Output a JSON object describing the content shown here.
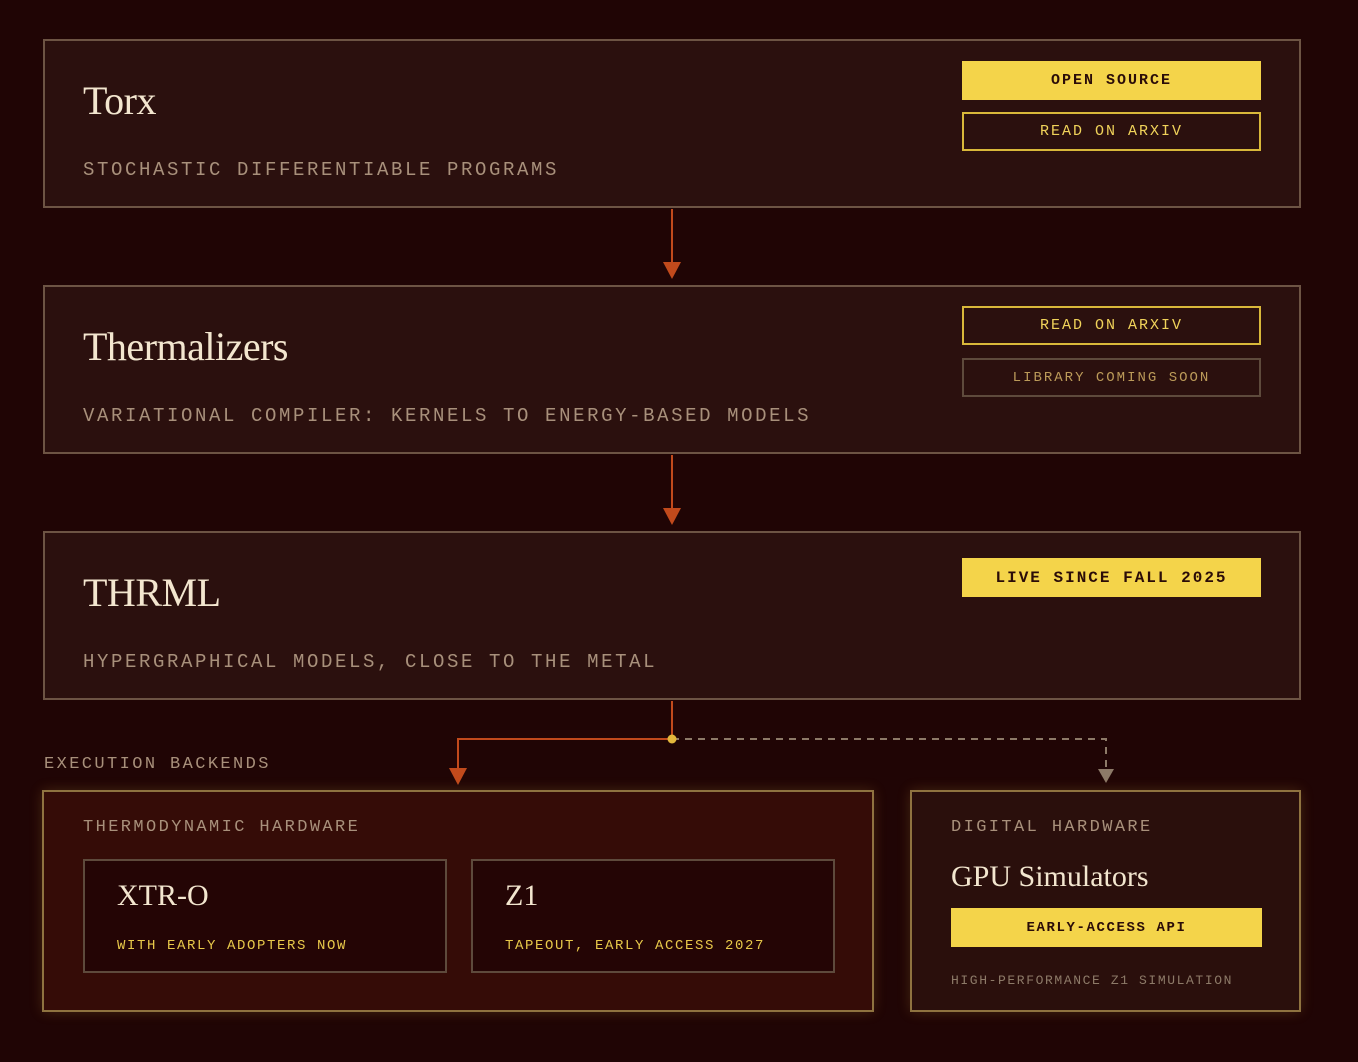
{
  "layers": [
    {
      "title": "Torx",
      "subtitle": "STOCHASTIC DIFFERENTIABLE PROGRAMS",
      "buttons": [
        "OPEN SOURCE",
        "READ ON ARXIV"
      ]
    },
    {
      "title": "Thermalizers",
      "subtitle": "VARIATIONAL COMPILER: KERNELS TO ENERGY-BASED MODELS",
      "buttons": [
        "READ ON ARXIV",
        "LIBRARY COMING SOON"
      ]
    },
    {
      "title": "THRML",
      "subtitle": "HYPERGRAPHICAL MODELS, CLOSE TO THE METAL",
      "buttons": [
        "LIVE SINCE FALL 2025"
      ]
    }
  ],
  "execution_backends": {
    "label": "EXECUTION BACKENDS",
    "thermodynamic": {
      "label": "THERMODYNAMIC HARDWARE",
      "chips": [
        {
          "title": "XTR-O",
          "subtitle": "WITH EARLY ADOPTERS NOW"
        },
        {
          "title": "Z1",
          "subtitle": "TAPEOUT, EARLY ACCESS 2027"
        }
      ]
    },
    "digital": {
      "label": "DIGITAL HARDWARE",
      "title": "GPU Simulators",
      "button": "EARLY-ACCESS API",
      "subtitle": "HIGH-PERFORMANCE Z1 SIMULATION"
    }
  },
  "colors": {
    "background": "#200505",
    "card": "#2b100e",
    "accent_yellow": "#f4d44a",
    "connector_orange": "#c14a1c",
    "connector_dashed": "#8d7a68"
  }
}
